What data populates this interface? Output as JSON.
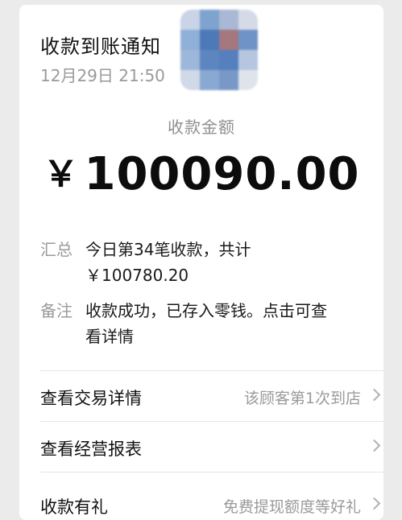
{
  "notification": {
    "title": "收款到账通知",
    "time": "12月29日 21:50"
  },
  "payment": {
    "amount_label": "收款金额",
    "currency": "￥",
    "amount": "100090.00"
  },
  "details": {
    "summary_key": "汇总",
    "summary_line1": "今日第34笔收款，共计",
    "summary_line2": "￥100780.20",
    "remark_key": "备注",
    "remark_line1": "收款成功，已存入零钱。点击可查",
    "remark_line2": "看详情"
  },
  "menu": [
    {
      "label": "查看交易详情",
      "hint": "该顾客第1次到店"
    },
    {
      "label": "查看经营报表",
      "hint": ""
    },
    {
      "label": "收款有礼",
      "hint": "免费提现额度等好礼"
    }
  ],
  "colors": {
    "background": "#ebebeb",
    "card": "#ffffff",
    "primary_text": "#111111",
    "secondary_text": "#9a9a9a"
  }
}
